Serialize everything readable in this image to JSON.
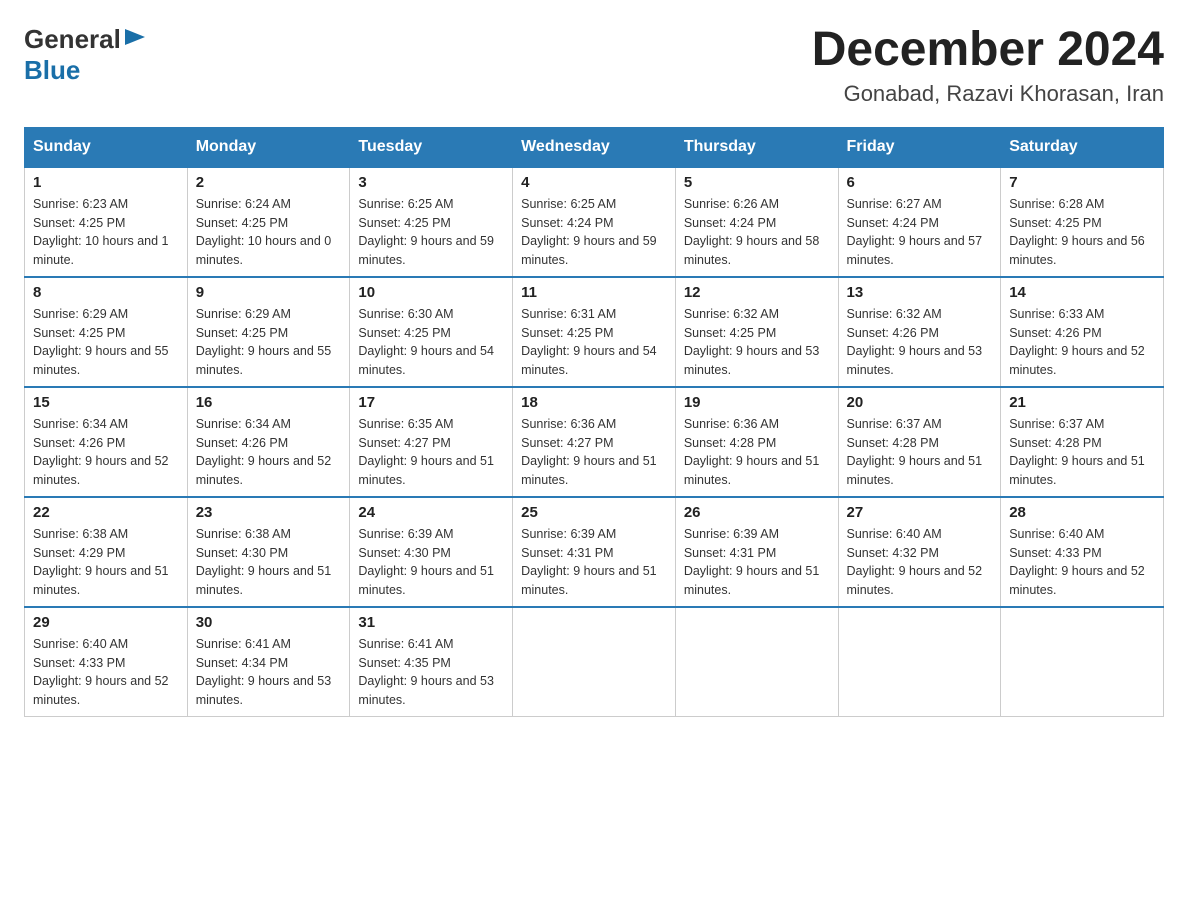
{
  "header": {
    "logo_general": "General",
    "logo_blue": "Blue",
    "month_title": "December 2024",
    "location": "Gonabad, Razavi Khorasan, Iran"
  },
  "days_of_week": [
    "Sunday",
    "Monday",
    "Tuesday",
    "Wednesday",
    "Thursday",
    "Friday",
    "Saturday"
  ],
  "weeks": [
    [
      {
        "day": "1",
        "sunrise": "6:23 AM",
        "sunset": "4:25 PM",
        "daylight": "10 hours and 1 minute."
      },
      {
        "day": "2",
        "sunrise": "6:24 AM",
        "sunset": "4:25 PM",
        "daylight": "10 hours and 0 minutes."
      },
      {
        "day": "3",
        "sunrise": "6:25 AM",
        "sunset": "4:25 PM",
        "daylight": "9 hours and 59 minutes."
      },
      {
        "day": "4",
        "sunrise": "6:25 AM",
        "sunset": "4:24 PM",
        "daylight": "9 hours and 59 minutes."
      },
      {
        "day": "5",
        "sunrise": "6:26 AM",
        "sunset": "4:24 PM",
        "daylight": "9 hours and 58 minutes."
      },
      {
        "day": "6",
        "sunrise": "6:27 AM",
        "sunset": "4:24 PM",
        "daylight": "9 hours and 57 minutes."
      },
      {
        "day": "7",
        "sunrise": "6:28 AM",
        "sunset": "4:25 PM",
        "daylight": "9 hours and 56 minutes."
      }
    ],
    [
      {
        "day": "8",
        "sunrise": "6:29 AM",
        "sunset": "4:25 PM",
        "daylight": "9 hours and 55 minutes."
      },
      {
        "day": "9",
        "sunrise": "6:29 AM",
        "sunset": "4:25 PM",
        "daylight": "9 hours and 55 minutes."
      },
      {
        "day": "10",
        "sunrise": "6:30 AM",
        "sunset": "4:25 PM",
        "daylight": "9 hours and 54 minutes."
      },
      {
        "day": "11",
        "sunrise": "6:31 AM",
        "sunset": "4:25 PM",
        "daylight": "9 hours and 54 minutes."
      },
      {
        "day": "12",
        "sunrise": "6:32 AM",
        "sunset": "4:25 PM",
        "daylight": "9 hours and 53 minutes."
      },
      {
        "day": "13",
        "sunrise": "6:32 AM",
        "sunset": "4:26 PM",
        "daylight": "9 hours and 53 minutes."
      },
      {
        "day": "14",
        "sunrise": "6:33 AM",
        "sunset": "4:26 PM",
        "daylight": "9 hours and 52 minutes."
      }
    ],
    [
      {
        "day": "15",
        "sunrise": "6:34 AM",
        "sunset": "4:26 PM",
        "daylight": "9 hours and 52 minutes."
      },
      {
        "day": "16",
        "sunrise": "6:34 AM",
        "sunset": "4:26 PM",
        "daylight": "9 hours and 52 minutes."
      },
      {
        "day": "17",
        "sunrise": "6:35 AM",
        "sunset": "4:27 PM",
        "daylight": "9 hours and 51 minutes."
      },
      {
        "day": "18",
        "sunrise": "6:36 AM",
        "sunset": "4:27 PM",
        "daylight": "9 hours and 51 minutes."
      },
      {
        "day": "19",
        "sunrise": "6:36 AM",
        "sunset": "4:28 PM",
        "daylight": "9 hours and 51 minutes."
      },
      {
        "day": "20",
        "sunrise": "6:37 AM",
        "sunset": "4:28 PM",
        "daylight": "9 hours and 51 minutes."
      },
      {
        "day": "21",
        "sunrise": "6:37 AM",
        "sunset": "4:28 PM",
        "daylight": "9 hours and 51 minutes."
      }
    ],
    [
      {
        "day": "22",
        "sunrise": "6:38 AM",
        "sunset": "4:29 PM",
        "daylight": "9 hours and 51 minutes."
      },
      {
        "day": "23",
        "sunrise": "6:38 AM",
        "sunset": "4:30 PM",
        "daylight": "9 hours and 51 minutes."
      },
      {
        "day": "24",
        "sunrise": "6:39 AM",
        "sunset": "4:30 PM",
        "daylight": "9 hours and 51 minutes."
      },
      {
        "day": "25",
        "sunrise": "6:39 AM",
        "sunset": "4:31 PM",
        "daylight": "9 hours and 51 minutes."
      },
      {
        "day": "26",
        "sunrise": "6:39 AM",
        "sunset": "4:31 PM",
        "daylight": "9 hours and 51 minutes."
      },
      {
        "day": "27",
        "sunrise": "6:40 AM",
        "sunset": "4:32 PM",
        "daylight": "9 hours and 52 minutes."
      },
      {
        "day": "28",
        "sunrise": "6:40 AM",
        "sunset": "4:33 PM",
        "daylight": "9 hours and 52 minutes."
      }
    ],
    [
      {
        "day": "29",
        "sunrise": "6:40 AM",
        "sunset": "4:33 PM",
        "daylight": "9 hours and 52 minutes."
      },
      {
        "day": "30",
        "sunrise": "6:41 AM",
        "sunset": "4:34 PM",
        "daylight": "9 hours and 53 minutes."
      },
      {
        "day": "31",
        "sunrise": "6:41 AM",
        "sunset": "4:35 PM",
        "daylight": "9 hours and 53 minutes."
      },
      null,
      null,
      null,
      null
    ]
  ],
  "labels": {
    "sunrise": "Sunrise:",
    "sunset": "Sunset:",
    "daylight": "Daylight:"
  }
}
